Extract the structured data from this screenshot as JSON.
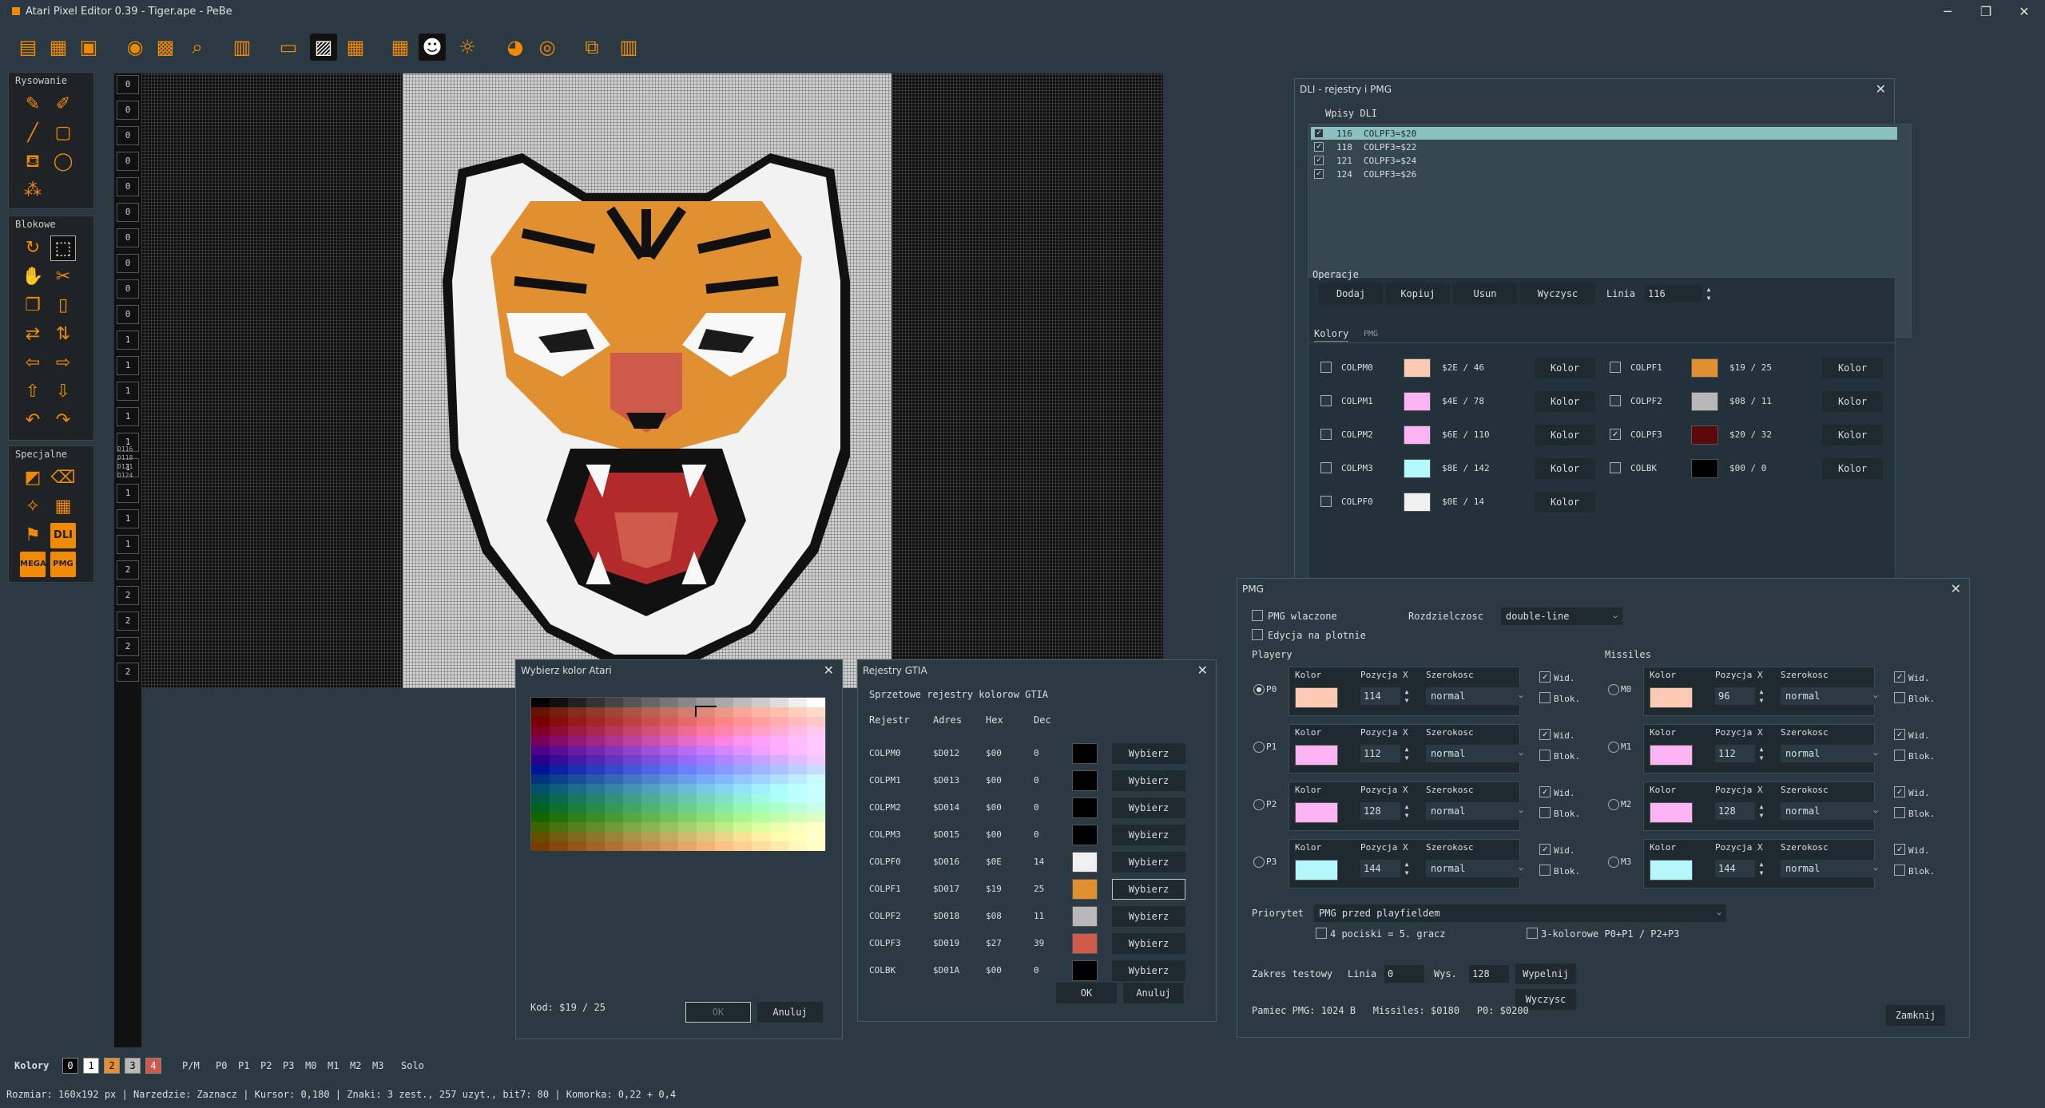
{
  "app": {
    "title": "Atari Pixel Editor 0.39 - Tiger.ape - PeBe",
    "min": "─",
    "max": "❐",
    "close": "✕"
  },
  "toolbar": [
    "new-file",
    "open-file",
    "save-file",
    "preview",
    "grid-view",
    "zoom",
    "properties",
    "frame",
    "grid-lines",
    "grid",
    "grid-large",
    "smiley",
    "bulb",
    "palette",
    "target",
    "export",
    "barcode"
  ],
  "tools": {
    "draw_title": "Rysowanie",
    "block_title": "Blokowe",
    "special_title": "Specjalne",
    "dli_label": "DLI",
    "pmg_label": "PMG",
    "mega_label": "MEGA"
  },
  "line_numbers": [
    "0",
    "0",
    "0",
    "0",
    "0",
    "0",
    "0",
    "0",
    "0",
    "0",
    "1",
    "1",
    "1",
    "1",
    "1",
    "1",
    "1",
    "1",
    "1",
    "2",
    "2",
    "2",
    "2",
    "2"
  ],
  "dli_markers": [
    "D116",
    "D118",
    "D121",
    "D124"
  ],
  "dli_window": {
    "title": "DLI - rejestry i PMG",
    "entries_label": "Wpisy DLI",
    "entries": [
      {
        "line": "116",
        "text": "COLPF3=$20",
        "checked": "✓"
      },
      {
        "line": "118",
        "text": "COLPF3=$22",
        "checked": "✓"
      },
      {
        "line": "121",
        "text": "COLPF3=$24",
        "checked": "✓"
      },
      {
        "line": "124",
        "text": "COLPF3=$26",
        "checked": "✓"
      }
    ],
    "ops_label": "Operacje",
    "add": "Dodaj",
    "copy": "Kopiuj",
    "remove": "Usun",
    "clear": "Wyczysc",
    "line_label": "Linia",
    "line_value": "116",
    "tab_colors": "Kolory",
    "tab_pmg": "PMG",
    "colors_left": [
      {
        "name": "COLPM0",
        "color": "#fdcab4",
        "val": "$2E / 46",
        "btn": "Kolor"
      },
      {
        "name": "COLPM1",
        "color": "#fdb4f4",
        "val": "$4E / 78",
        "btn": "Kolor"
      },
      {
        "name": "COLPM2",
        "color": "#fdb4f4",
        "val": "$6E / 110",
        "btn": "Kolor"
      },
      {
        "name": "COLPM3",
        "color": "#b4f8fd",
        "val": "$8E / 142",
        "btn": "Kolor"
      },
      {
        "name": "COLPF0",
        "color": "#f0f0f0",
        "val": "$0E / 14",
        "btn": "Kolor"
      }
    ],
    "colors_right": [
      {
        "name": "COLPF1",
        "color": "#e09030",
        "val": "$19 / 25",
        "btn": "Kolor",
        "checked": ""
      },
      {
        "name": "COLPF2",
        "color": "#b8b8b8",
        "val": "$08 / 11",
        "btn": "Kolor",
        "checked": ""
      },
      {
        "name": "COLPF3",
        "color": "#5a0808",
        "val": "$20 / 32",
        "btn": "Kolor",
        "checked": "✓"
      },
      {
        "name": "COLBK",
        "color": "#000000",
        "val": "$00 / 0",
        "btn": "Kolor",
        "checked": ""
      }
    ]
  },
  "pmg_window": {
    "title": "PMG",
    "enabled": "PMG wlaczone",
    "edit_canvas": "Edycja na plotnie",
    "resolution_label": "Rozdzielczosc",
    "resolution": "double-line",
    "players_label": "Playery",
    "missiles_label": "Missiles",
    "col_color": "Kolor",
    "col_pos": "Pozycja X",
    "col_width": "Szerokosc",
    "vis": "Wid.",
    "block": "Blok.",
    "players": [
      {
        "name": "P0",
        "color": "#fdcab4",
        "pos": "114",
        "width": "normal"
      },
      {
        "name": "P1",
        "color": "#fdb4f4",
        "pos": "112",
        "width": "normal"
      },
      {
        "name": "P2",
        "color": "#fdb4f4",
        "pos": "128",
        "width": "normal"
      },
      {
        "name": "P3",
        "color": "#b4f8fd",
        "pos": "144",
        "width": "normal"
      }
    ],
    "missiles": [
      {
        "name": "M0",
        "color": "#fdcab4",
        "pos": "96",
        "width": "normal"
      },
      {
        "name": "M1",
        "color": "#fdb4f4",
        "pos": "112",
        "width": "normal"
      },
      {
        "name": "M2",
        "color": "#fdb4f4",
        "pos": "128",
        "width": "normal"
      },
      {
        "name": "M3",
        "color": "#b4f8fd",
        "pos": "144",
        "width": "normal"
      }
    ],
    "priority_label": "Priorytet",
    "priority": "PMG przed playfieldem",
    "five_player": "4 pociski = 5. gracz",
    "three_color": "3-kolorowe P0+P1 / P2+P3",
    "test_label": "Zakres testowy",
    "line_label": "Linia",
    "line_value": "0",
    "height_label": "Wys.",
    "height_value": "128",
    "fill": "Wypelnij",
    "clear": "Wyczysc",
    "memory": "Pamiec PMG: 1024 B   Missiles: $0180   P0: $0200",
    "close": "Zamknij"
  },
  "palette_window": {
    "title": "Wybierz kolor Atari",
    "code": "Kod: $19 / 25",
    "ok": "OK",
    "cancel": "Anuluj"
  },
  "gtia_window": {
    "title": "Rejestry GTIA",
    "subtitle": "Sprzetowe rejestry kolorow GTIA",
    "headers": [
      "Rejestr",
      "Adres",
      "Hex",
      "Dec"
    ],
    "rows": [
      {
        "reg": "COLPM0",
        "addr": "$D012",
        "hex": "$00",
        "dec": "0",
        "color": "#000000",
        "btn": "Wybierz"
      },
      {
        "reg": "COLPM1",
        "addr": "$D013",
        "hex": "$00",
        "dec": "0",
        "color": "#000000",
        "btn": "Wybierz"
      },
      {
        "reg": "COLPM2",
        "addr": "$D014",
        "hex": "$00",
        "dec": "0",
        "color": "#000000",
        "btn": "Wybierz"
      },
      {
        "reg": "COLPM3",
        "addr": "$D015",
        "hex": "$00",
        "dec": "0",
        "color": "#000000",
        "btn": "Wybierz"
      },
      {
        "reg": "COLPF0",
        "addr": "$D016",
        "hex": "$0E",
        "dec": "14",
        "color": "#f0f0f0",
        "btn": "Wybierz"
      },
      {
        "reg": "COLPF1",
        "addr": "$D017",
        "hex": "$19",
        "dec": "25",
        "color": "#e09030",
        "btn": "Wybierz"
      },
      {
        "reg": "COLPF2",
        "addr": "$D018",
        "hex": "$08",
        "dec": "11",
        "color": "#b8b8b8",
        "btn": "Wybierz"
      },
      {
        "reg": "COLPF3",
        "addr": "$D019",
        "hex": "$27",
        "dec": "39",
        "color": "#d05a4a",
        "btn": "Wybierz"
      },
      {
        "reg": "COLBK",
        "addr": "$D01A",
        "hex": "$00",
        "dec": "0",
        "color": "#000000",
        "btn": "Wybierz"
      }
    ],
    "ok": "OK",
    "cancel": "Anuluj"
  },
  "bottom": {
    "colors_label": "Kolory",
    "boxes": [
      {
        "t": "0",
        "bg": "#000000",
        "fg": "#ffffff"
      },
      {
        "t": "1",
        "bg": "#ffffff",
        "fg": "#000000"
      },
      {
        "t": "2",
        "bg": "#e09030",
        "fg": "#000000"
      },
      {
        "t": "3",
        "bg": "#b8b8b8",
        "fg": "#000000"
      },
      {
        "t": "4",
        "bg": "#d05a4a",
        "fg": "#ffffff"
      }
    ],
    "pm_items": [
      "P/M",
      "P0",
      "P1",
      "P2",
      "P3",
      "M0",
      "M1",
      "M2",
      "M3",
      "Solo"
    ]
  },
  "status": "Rozmiar: 160x192 px | Narzedzie: Zaznacz | Kursor: 0,180 | Znaki: 3 zest., 257 uzyt., bit7: 80 | Komorka: 0,22 + 0,4"
}
